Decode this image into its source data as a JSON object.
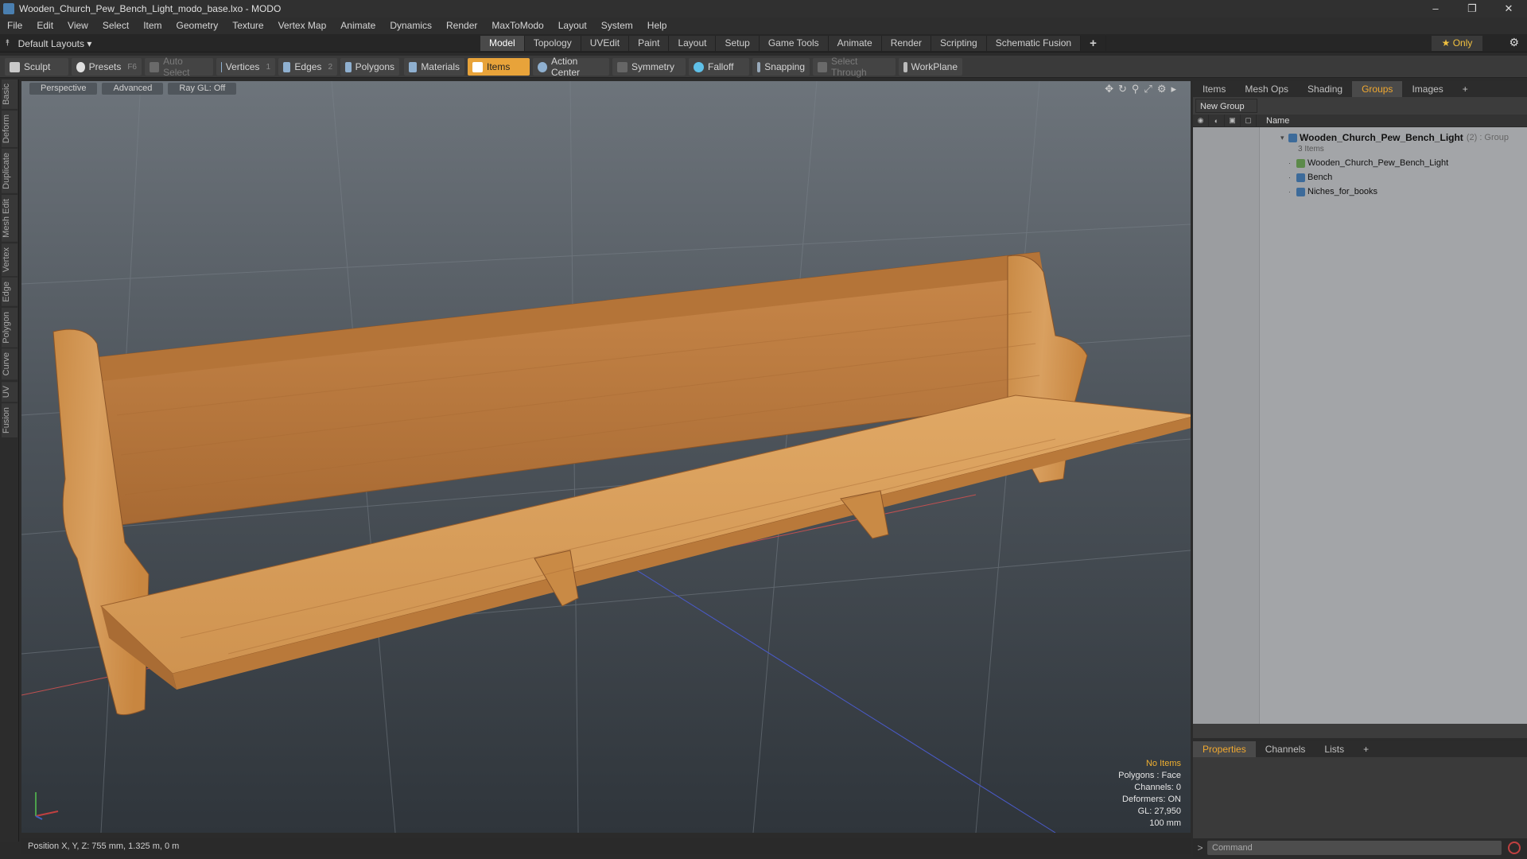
{
  "window": {
    "title": "Wooden_Church_Pew_Bench_Light_modo_base.lxo - MODO",
    "buttons": [
      "–",
      "❐",
      "✕"
    ]
  },
  "menu": [
    "File",
    "Edit",
    "View",
    "Select",
    "Item",
    "Geometry",
    "Texture",
    "Vertex Map",
    "Animate",
    "Dynamics",
    "Render",
    "MaxToModo",
    "Layout",
    "System",
    "Help"
  ],
  "layout_bar": {
    "layout_dropdown": "Default Layouts ▾",
    "tabs": [
      "Model",
      "Topology",
      "UVEdit",
      "Paint",
      "Layout",
      "Setup",
      "Game Tools",
      "Animate",
      "Render",
      "Scripting",
      "Schematic Fusion"
    ],
    "active_tab": "Model",
    "only_label": "★ Only"
  },
  "toolbar": {
    "sculpt": "Sculpt",
    "presets": "Presets",
    "presets_key": "F6",
    "auto_select": "Auto Select",
    "vertices": "Vertices",
    "vertices_key": "1",
    "edges": "Edges",
    "edges_key": "2",
    "polygons": "Polygons",
    "materials": "Materials",
    "items": "Items",
    "action_center": "Action Center",
    "symmetry": "Symmetry",
    "falloff": "Falloff",
    "snapping": "Snapping",
    "select_through": "Select Through",
    "workplane": "WorkPlane"
  },
  "left_tabs": [
    "Basic",
    "Deform",
    "Duplicate",
    "Mesh Edit",
    "Vertex",
    "Edge",
    "Polygon",
    "Curve",
    "UV",
    "Fusion"
  ],
  "viewport": {
    "view_mode": "Perspective",
    "shading": "Advanced",
    "raygl": "Ray GL: Off",
    "info": {
      "selection": "No Items",
      "polygons": "Polygons : Face",
      "channels": "Channels: 0",
      "deformers": "Deformers: ON",
      "gl": "GL: 27,950",
      "scale": "100 mm"
    }
  },
  "status_bar": {
    "position": "Position X, Y, Z:   755 mm, 1.325 m, 0 m"
  },
  "right_panel": {
    "tabs": [
      "Items",
      "Mesh Ops",
      "Shading",
      "Groups",
      "Images"
    ],
    "active_tab": "Groups",
    "new_group": "New Group",
    "name_header": "Name",
    "group": {
      "name": "Wooden_Church_Pew_Bench_Light",
      "count": "(2) : Group",
      "subtitle": "3 Items",
      "children": [
        "Wooden_Church_Pew_Bench_Light",
        "Bench",
        "Niches_for_books"
      ]
    }
  },
  "bottom_panel": {
    "tabs": [
      "Properties",
      "Channels",
      "Lists"
    ],
    "active_tab": "Properties"
  },
  "command": {
    "placeholder": "Command"
  },
  "colors": {
    "accent": "#e8a33a",
    "wood_light": "#d79a55",
    "wood_dark": "#a8652a",
    "background": "#2b2b2b"
  }
}
